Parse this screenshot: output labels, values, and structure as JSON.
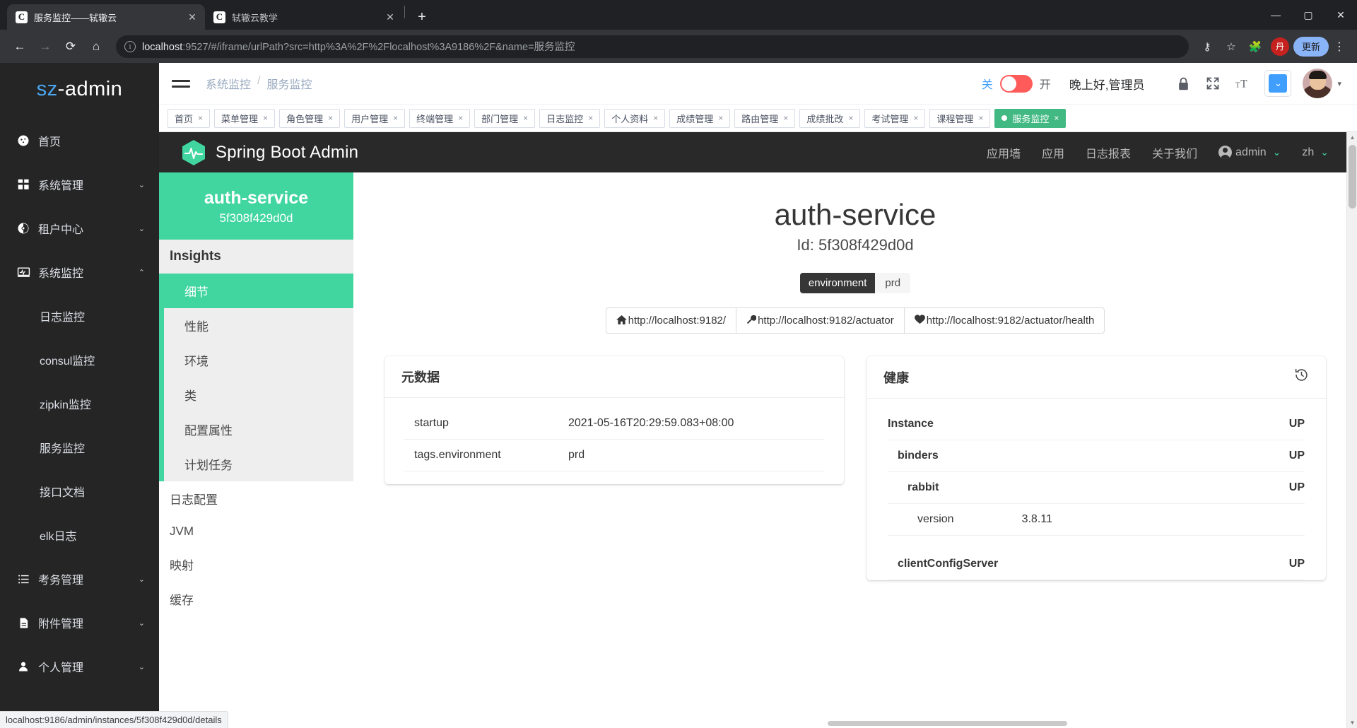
{
  "browser": {
    "tabs": [
      {
        "favicon": "C",
        "title": "服务监控——轼辙云",
        "close": "✕",
        "active": true
      },
      {
        "favicon": "C",
        "title": "轼辙云教学",
        "close": "✕",
        "active": false
      }
    ],
    "new_tab_label": "+",
    "window_controls": {
      "minimize": "—",
      "maximize": "▢",
      "close": "✕"
    },
    "nav": {
      "back": "←",
      "forward": "→",
      "reload": "⟳",
      "home": "⌂"
    },
    "url_scheme": "localhost",
    "url_rest": ":9527/#/iframe/urlPath?src=http%3A%2F%2Flocalhost%3A9186%2F&name=服务监控",
    "key_icon": "⚷",
    "star_icon": "☆",
    "extension_icon": "🧩",
    "profile_initial": "丹",
    "update_label": "更新",
    "kebab": "⋮"
  },
  "sidebar": {
    "logo_prefix": "sz",
    "logo_suffix": "-admin",
    "items": [
      {
        "icon": "gauge-icon",
        "glyph": "◕",
        "label": "首页",
        "arrow": ""
      },
      {
        "icon": "grid-icon",
        "glyph": "▦",
        "label": "系统管理",
        "arrow": "⌄"
      },
      {
        "icon": "tenant-icon",
        "glyph": "◈",
        "label": "租户中心",
        "arrow": "⌄"
      },
      {
        "icon": "monitor-icon",
        "glyph": "▭",
        "label": "系统监控",
        "arrow": "⌃"
      }
    ],
    "submenu": [
      {
        "label": "日志监控",
        "active": false
      },
      {
        "label": "consul监控",
        "active": false
      },
      {
        "label": "zipkin监控",
        "active": false
      },
      {
        "label": "服务监控",
        "active": false
      },
      {
        "label": "接口文档",
        "active": false
      },
      {
        "label": "elk日志",
        "active": false
      }
    ],
    "items_bottom": [
      {
        "icon": "list-icon",
        "glyph": "☰",
        "label": "考务管理",
        "arrow": "⌄"
      },
      {
        "icon": "file-icon",
        "glyph": "▤",
        "label": "附件管理",
        "arrow": "⌄"
      },
      {
        "icon": "user-icon",
        "glyph": "👤",
        "label": "个人管理",
        "arrow": "⌄"
      }
    ]
  },
  "topbar": {
    "breadcrumb": {
      "parent": "系统监控",
      "separator": "/",
      "current": "服务监控"
    },
    "switch": {
      "off_label": "关",
      "on_label": "开",
      "color": "#ff5b5b"
    },
    "greeting": "晚上好,管理员",
    "icons": {
      "lock": "🔒",
      "fullscreen": "⛶",
      "fontsize": "T"
    },
    "blue_button_glyph": "⌄",
    "avatar_caret": "▾"
  },
  "tags": [
    {
      "label": "首页",
      "close": "×",
      "active": false
    },
    {
      "label": "菜单管理",
      "close": "×",
      "active": false
    },
    {
      "label": "角色管理",
      "close": "×",
      "active": false
    },
    {
      "label": "用户管理",
      "close": "×",
      "active": false
    },
    {
      "label": "终端管理",
      "close": "×",
      "active": false
    },
    {
      "label": "部门管理",
      "close": "×",
      "active": false
    },
    {
      "label": "日志监控",
      "close": "×",
      "active": false
    },
    {
      "label": "个人资料",
      "close": "×",
      "active": false
    },
    {
      "label": "成绩管理",
      "close": "×",
      "active": false
    },
    {
      "label": "路由管理",
      "close": "×",
      "active": false
    },
    {
      "label": "成绩批改",
      "close": "×",
      "active": false
    },
    {
      "label": "考试管理",
      "close": "×",
      "active": false
    },
    {
      "label": "课程管理",
      "close": "×",
      "active": false
    },
    {
      "label": "服务监控",
      "close": "×",
      "active": true
    }
  ],
  "sba": {
    "brand": "Spring Boot Admin",
    "nav_links": [
      "应用墙",
      "应用",
      "日志报表",
      "关于我们"
    ],
    "user": "admin",
    "user_caret": "⌄",
    "language": "zh",
    "language_caret": "⌄",
    "side": {
      "app_name": "auth-service",
      "app_id": "5f308f429d0d",
      "section_title": "Insights",
      "insights": [
        {
          "label": "细节",
          "active": true
        },
        {
          "label": "性能",
          "active": false
        },
        {
          "label": "环境",
          "active": false
        },
        {
          "label": "类",
          "active": false
        },
        {
          "label": "配置属性",
          "active": false
        },
        {
          "label": "计划任务",
          "active": false
        }
      ],
      "others": [
        "日志配置",
        "JVM",
        "映射",
        "缓存"
      ]
    },
    "main": {
      "title": "auth-service",
      "subtitle": "Id: 5f308f429d0d",
      "tag_key": "environment",
      "tag_value": "prd",
      "links": [
        {
          "icon": "home-icon",
          "glyph": "⌂",
          "label": "http://localhost:9182/"
        },
        {
          "icon": "wrench-icon",
          "glyph": "🔧",
          "label": "http://localhost:9182/actuator"
        },
        {
          "icon": "heart-icon",
          "glyph": "♥",
          "label": "http://localhost:9182/actuator/health"
        }
      ],
      "metadata_card": {
        "title": "元数据",
        "rows": [
          {
            "key": "startup",
            "value": "2021-05-16T20:29:59.083+08:00"
          },
          {
            "key": "tags.environment",
            "value": "prd"
          }
        ]
      },
      "health_card": {
        "title": "健康",
        "history_icon": "↺",
        "rows": [
          {
            "key": "Instance",
            "value": "UP",
            "level": 1,
            "bold": true
          },
          {
            "key": "binders",
            "value": "UP",
            "level": 2,
            "bold": true
          },
          {
            "key": "rabbit",
            "value": "UP",
            "level": 3,
            "bold": true
          },
          {
            "key": "version",
            "value": "3.8.11",
            "level": 3,
            "bold": false
          },
          {
            "key": "clientConfigServer",
            "value": "UP",
            "level": 2,
            "bold": true
          }
        ]
      }
    }
  },
  "statusbar": {
    "text": "localhost:9186/admin/instances/5f308f429d0d/details"
  }
}
